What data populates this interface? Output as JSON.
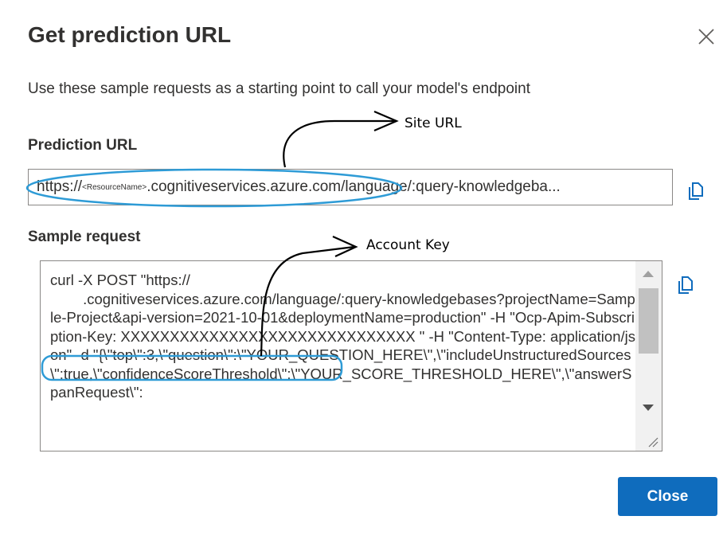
{
  "dialog": {
    "title": "Get prediction URL",
    "subtitle": "Use these sample requests as a starting point to call your model's endpoint",
    "close_icon": "close-icon"
  },
  "prediction_url": {
    "label": "Prediction URL",
    "value_prefix": "https://",
    "value_placeholder": "<ResourceName>",
    "value_suffix": ".cognitiveservices.azure.com/language/:query-knowledgeba...",
    "copy_icon": "copy-icon"
  },
  "sample_request": {
    "label": "Sample request",
    "text": "curl -X POST \"https://\n        .cognitiveservices.azure.com/language/:query-knowledgebases?projectName=Sample-Project&api-version=2021-10-01&deploymentName=production\" -H \"Ocp-Apim-Subscription-Key: XXXXXXXXXXXXXXXXXXXXXXXXXXXXXX \" -H \"Content-Type: application/json\" -d \"{\\\"top\\\":3,\\\"question\\\":\\\"YOUR_QUESTION_HERE\\\",\\\"includeUnstructuredSources\\\":true,\\\"confidenceScoreThreshold\\\":\\\"YOUR_SCORE_THRESHOLD_HERE\\\",\\\"answerSpanRequest\\\":",
    "copy_icon": "copy-icon"
  },
  "footer": {
    "close_label": "Close"
  },
  "annotations": {
    "site_url": "Site URL",
    "account_key": "Account Key",
    "highlight_color": "#2e9bd6"
  }
}
